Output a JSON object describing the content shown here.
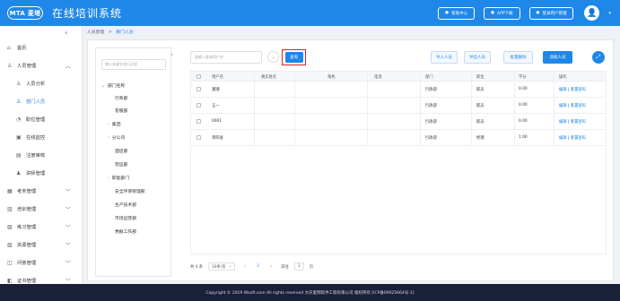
{
  "header": {
    "logo_text": "MTA 麦塔",
    "title": "在线培训系统",
    "actions": [
      {
        "icon": "help-icon",
        "label": "帮助中心"
      },
      {
        "icon": "mobile-icon",
        "label": "APP下载"
      },
      {
        "icon": "user-icon",
        "label": "登录用户管理"
      }
    ],
    "avatar_icon": "avatar-icon"
  },
  "sidebar": {
    "items": [
      {
        "label": "首页",
        "icon": "home-icon",
        "level": 0,
        "expandable": false
      },
      {
        "label": "人员管理",
        "icon": "person-icon",
        "level": 0,
        "expandable": true,
        "expanded": true
      },
      {
        "label": "人员分析",
        "icon": "person-analysis-icon",
        "level": 1
      },
      {
        "label": "部门人员",
        "icon": "department-icon",
        "level": 1,
        "active": true
      },
      {
        "label": "职位管理",
        "icon": "position-icon",
        "level": 1
      },
      {
        "label": "在线监控",
        "icon": "monitor-icon",
        "level": 1
      },
      {
        "label": "注册审核",
        "icon": "audit-icon",
        "level": 1
      },
      {
        "label": "讲师管理",
        "icon": "lecturer-icon",
        "level": 1
      },
      {
        "label": "考务管理",
        "icon": "exam-icon",
        "level": 0,
        "expandable": true
      },
      {
        "label": "培训管理",
        "icon": "training-icon",
        "level": 0,
        "expandable": true
      },
      {
        "label": "练习管理",
        "icon": "practice-icon",
        "level": 0,
        "expandable": true
      },
      {
        "label": "资源管理",
        "icon": "resource-icon",
        "level": 0,
        "expandable": true
      },
      {
        "label": "问答管理",
        "icon": "qa-icon",
        "level": 0,
        "expandable": true
      },
      {
        "label": "证书管理",
        "icon": "certificate-icon",
        "level": 0,
        "expandable": true
      }
    ]
  },
  "breadcrumb": {
    "parent": "人员管理",
    "separator": ">",
    "current": "部门人员"
  },
  "tree": {
    "search_placeholder": "输入关键字进行过滤",
    "nodes": [
      {
        "label": "部门名称",
        "level": 0,
        "arrow": "⌄"
      },
      {
        "label": "行政部",
        "level": 1,
        "arrow": ""
      },
      {
        "label": "客服部",
        "level": 1,
        "arrow": ""
      },
      {
        "label": "集团",
        "level": 1,
        "arrow": "›"
      },
      {
        "label": "分公司",
        "level": 1,
        "arrow": "›"
      },
      {
        "label": "酒店部",
        "level": 1,
        "arrow": ""
      },
      {
        "label": "营运部",
        "level": 1,
        "arrow": ""
      },
      {
        "label": "职能部门",
        "level": 1,
        "arrow": "›"
      },
      {
        "label": "安全环保管理部",
        "level": 1,
        "arrow": ""
      },
      {
        "label": "生产技术部",
        "level": 1,
        "arrow": ""
      },
      {
        "label": "市场运营部",
        "level": 1,
        "arrow": ""
      },
      {
        "label": "党群工作部",
        "level": 1,
        "arrow": ""
      }
    ]
  },
  "toolbar": {
    "search_placeholder": "请输入查询用户名",
    "query_label": "查询",
    "import_label": "导入人员",
    "export_label": "导出人员",
    "batch_delete_label": "批量删除",
    "add_label": "添加人员"
  },
  "table": {
    "columns": [
      "",
      "用户名",
      "真实姓名",
      "角色",
      "电话",
      "",
      "部门",
      "职位",
      "学分",
      "操作"
    ],
    "rows": [
      {
        "username": "潮潮",
        "realname": "",
        "role": "",
        "phone": "",
        "dept": "行政部",
        "position": "职员",
        "credit": "0.00"
      },
      {
        "username": "王一",
        "realname": "",
        "role": "",
        "phone": "",
        "dept": "行政部",
        "position": "职员",
        "credit": "0.00"
      },
      {
        "username": "0001",
        "realname": "",
        "role": "",
        "phone": "",
        "dept": "行政部",
        "position": "职员",
        "credit": "0.00"
      },
      {
        "username": "李四发",
        "realname": "",
        "role": "",
        "phone": "",
        "dept": "行政部",
        "position": "经理",
        "credit": "1.00"
      }
    ],
    "op_edit": "编辑",
    "op_sep": "|",
    "op_reset": "重置密码"
  },
  "pager": {
    "total": "共 4 条",
    "page_size": "10条/页",
    "prev": "‹",
    "current": "1",
    "next": "›",
    "goto_label": "前往",
    "goto_value": "1",
    "page_unit": "页"
  },
  "footer": {
    "text": "Copyright © 2019 Wsoft.com All rights reserved 大庆麦网软件工程有限公司 版权所有 [ICP备09025664号-1]"
  },
  "colors": {
    "primary": "#1f87e8",
    "footer": "#1a1f3a",
    "highlight": "#e02020"
  }
}
